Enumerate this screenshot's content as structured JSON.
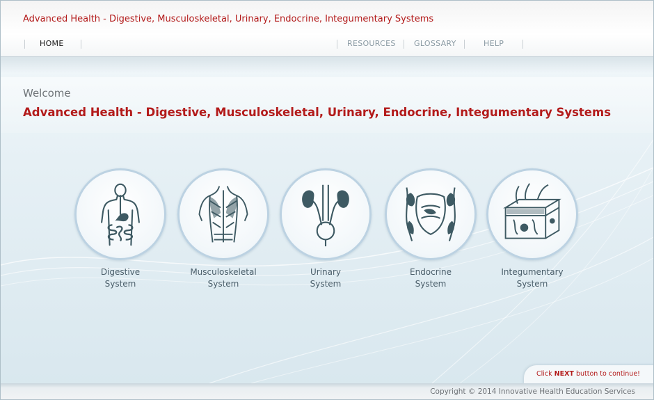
{
  "header": {
    "app_title": "Advanced Health - Digestive, Musculoskeletal, Urinary, Endocrine, Integumentary Systems",
    "nav": {
      "home": "HOME",
      "resources": "RESOURCES",
      "glossary": "GLOSSARY",
      "help": "HELP"
    }
  },
  "main": {
    "welcome": "Welcome",
    "title": "Advanced Health  - Digestive, Musculoskeletal, Urinary, Endocrine, Integumentary Systems",
    "systems": [
      {
        "line1": "Digestive",
        "line2": "System",
        "icon": "digestive-system-icon"
      },
      {
        "line1": "Musculoskeletal",
        "line2": "System",
        "icon": "musculoskeletal-system-icon"
      },
      {
        "line1": "Urinary",
        "line2": "System",
        "icon": "urinary-system-icon"
      },
      {
        "line1": "Endocrine",
        "line2": "System",
        "icon": "endocrine-system-icon"
      },
      {
        "line1": "Integumentary",
        "line2": "System",
        "icon": "integumentary-system-icon"
      }
    ]
  },
  "footer": {
    "next_prefix": "Click ",
    "next_strong": "NEXT",
    "next_suffix": " button to continue!",
    "copyright": "Copyright © 2014 Innovative Health Education Services"
  },
  "colors": {
    "accent_red": "#b31b1b",
    "circle_border": "#bcd2e2",
    "illustration": "#3e5a63"
  }
}
